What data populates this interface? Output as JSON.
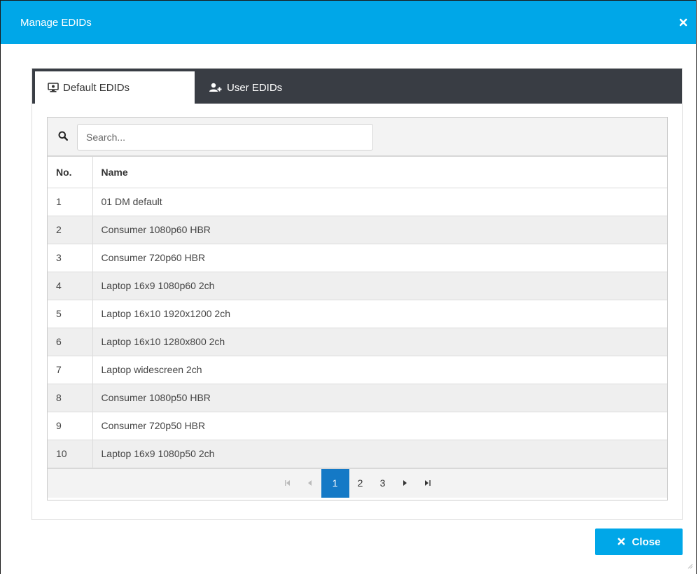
{
  "dialog": {
    "title": "Manage EDIDs",
    "close_label": "Close",
    "accent_color": "#00a7e8"
  },
  "tabs": [
    {
      "label": "Default EDIDs",
      "icon": "monitor-icon",
      "active": true
    },
    {
      "label": "User EDIDs",
      "icon": "add-user-icon",
      "active": false
    }
  ],
  "search": {
    "placeholder": "Search...",
    "value": ""
  },
  "table": {
    "columns": [
      "No.",
      "Name"
    ],
    "rows": [
      {
        "no": "1",
        "name": "01 DM default"
      },
      {
        "no": "2",
        "name": "Consumer 1080p60 HBR"
      },
      {
        "no": "3",
        "name": "Consumer 720p60 HBR"
      },
      {
        "no": "4",
        "name": "Laptop 16x9 1080p60 2ch"
      },
      {
        "no": "5",
        "name": "Laptop 16x10 1920x1200 2ch"
      },
      {
        "no": "6",
        "name": "Laptop 16x10 1280x800 2ch"
      },
      {
        "no": "7",
        "name": "Laptop widescreen 2ch"
      },
      {
        "no": "8",
        "name": "Consumer 1080p50 HBR"
      },
      {
        "no": "9",
        "name": "Consumer 720p50 HBR"
      },
      {
        "no": "10",
        "name": "Laptop 16x9 1080p50 2ch"
      }
    ]
  },
  "pagination": {
    "pages": [
      "1",
      "2",
      "3"
    ],
    "current": "1"
  }
}
